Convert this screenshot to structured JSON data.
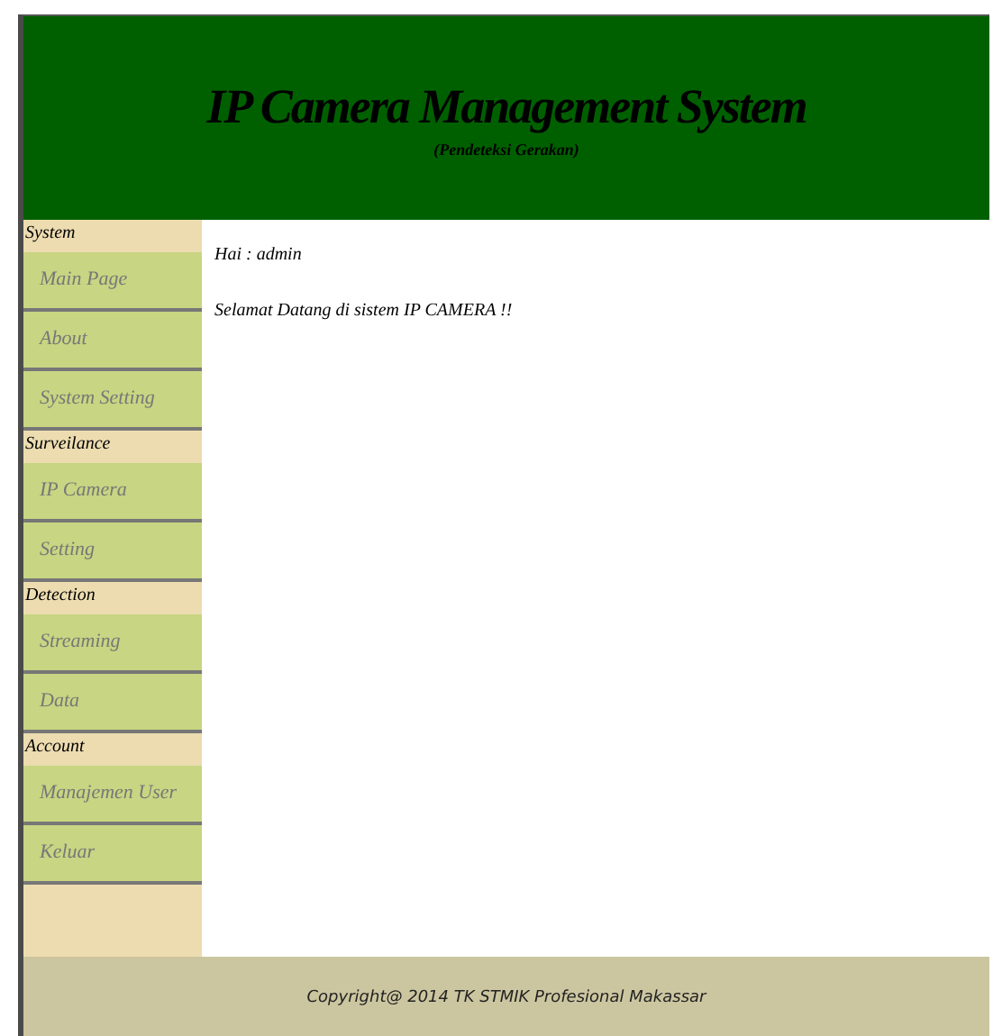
{
  "header": {
    "title": "IP Camera Management System",
    "subtitle": "(Pendeteksi Gerakan)"
  },
  "sidebar": {
    "sections": [
      {
        "title": "System",
        "items": [
          {
            "label": "Main Page"
          },
          {
            "label": "About"
          },
          {
            "label": "System Setting"
          }
        ]
      },
      {
        "title": "Surveilance",
        "items": [
          {
            "label": "IP Camera"
          },
          {
            "label": "Setting"
          }
        ]
      },
      {
        "title": "Detection",
        "items": [
          {
            "label": "Streaming"
          },
          {
            "label": "Data"
          }
        ]
      },
      {
        "title": "Account",
        "items": [
          {
            "label": "Manajemen User"
          },
          {
            "label": "Keluar"
          }
        ]
      }
    ]
  },
  "content": {
    "greeting": "Hai : admin",
    "message": "Selamat Datang di sistem IP CAMERA !!"
  },
  "footer": {
    "text": "Copyright@ 2014 TK STMIK Profesional Makassar"
  }
}
